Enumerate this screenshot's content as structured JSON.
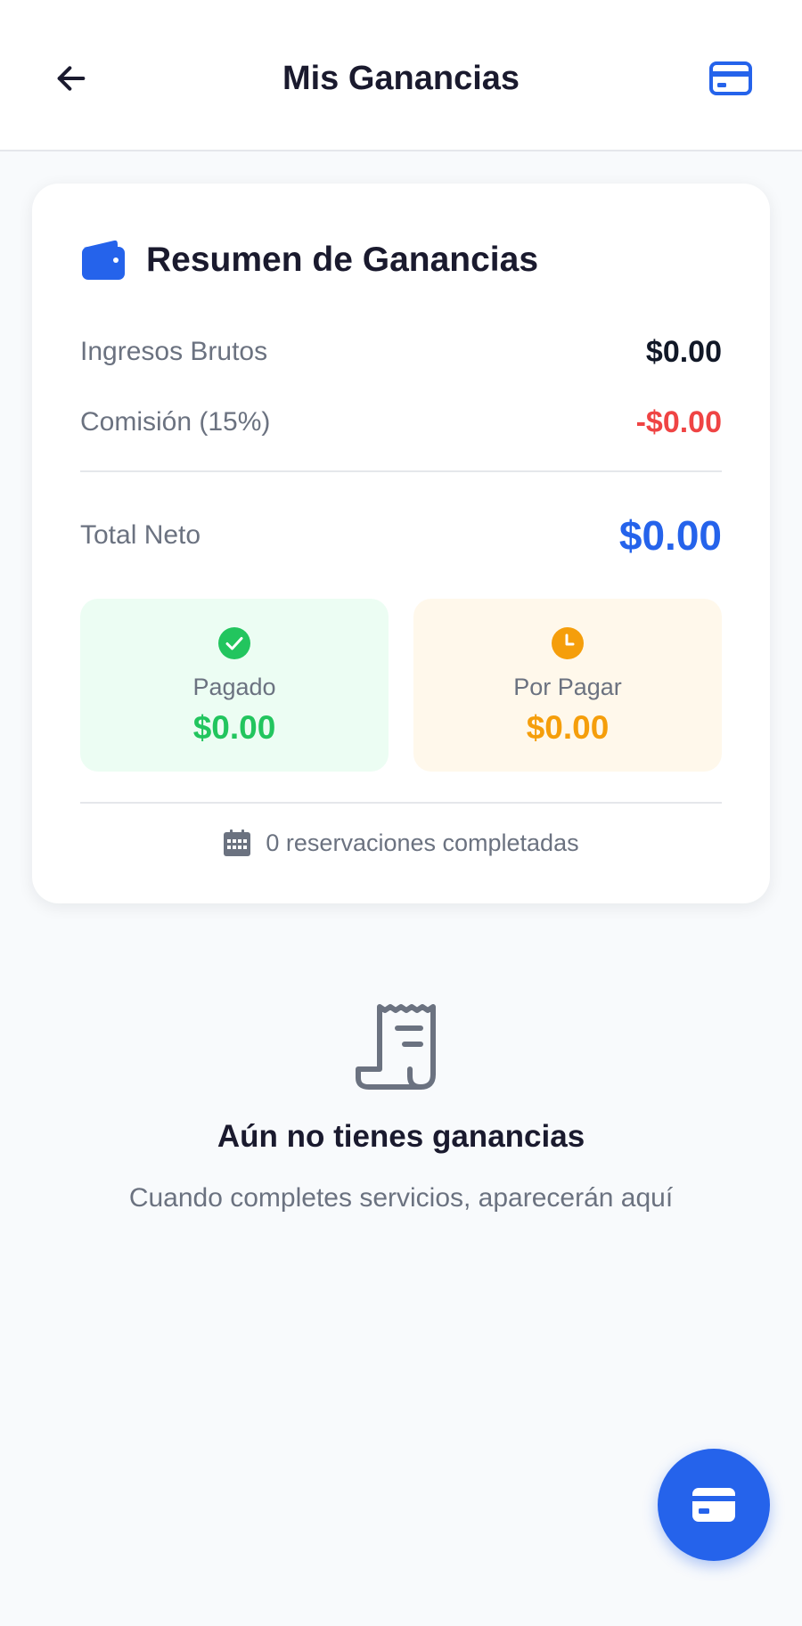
{
  "header": {
    "title": "Mis Ganancias",
    "back_icon": "arrow-left-icon",
    "card_icon": "credit-card-icon"
  },
  "summary": {
    "title": "Resumen de Ganancias",
    "icon": "wallet-icon",
    "gross_label": "Ingresos Brutos",
    "gross_value": "$0.00",
    "commission_label": "Comisión (15%)",
    "commission_value": "-$0.00",
    "net_label": "Total Neto",
    "net_value": "$0.00",
    "paid": {
      "label": "Pagado",
      "amount": "$0.00",
      "icon": "check-circle-icon"
    },
    "pending": {
      "label": "Por Pagar",
      "amount": "$0.00",
      "icon": "clock-icon"
    },
    "reservations_text": "0 reservaciones completadas",
    "reservations_icon": "calendar-icon"
  },
  "empty_state": {
    "icon": "receipt-icon",
    "title": "Aún no tienes ganancias",
    "subtitle": "Cuando completes servicios, aparecerán aquí"
  },
  "fab": {
    "icon": "credit-card-icon"
  },
  "colors": {
    "accent": "#2563eb",
    "danger": "#ef4444",
    "success": "#22c55e",
    "warning": "#f59e0b"
  }
}
